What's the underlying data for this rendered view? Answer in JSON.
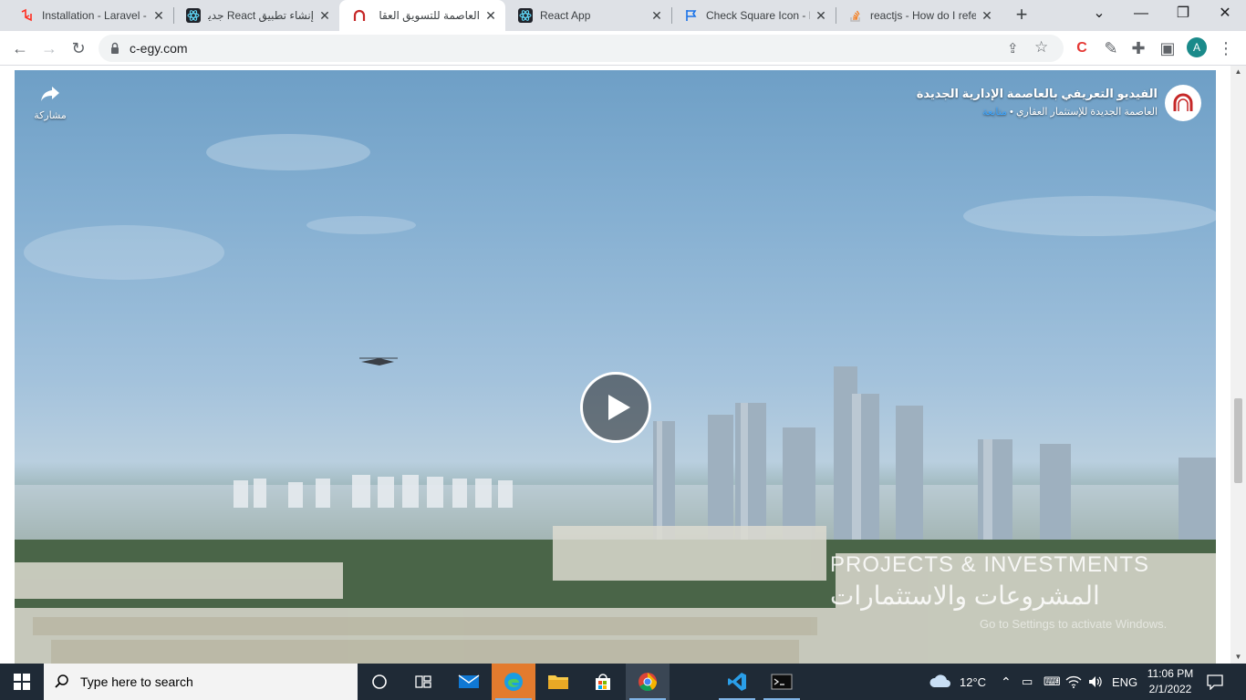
{
  "browser": {
    "tabs": [
      {
        "title": "Installation - Laravel -",
        "icon": "laravel-icon",
        "active": false
      },
      {
        "title": "إنشاء تطبيق React جديد",
        "icon": "react-icon",
        "active": false
      },
      {
        "title": "العاصمة للتسويق العقا",
        "icon": "capital-logo-icon",
        "active": true
      },
      {
        "title": "React App",
        "icon": "react-icon",
        "active": false
      },
      {
        "title": "Check Square Icon - R",
        "icon": "flag-icon",
        "active": false
      },
      {
        "title": "reactjs - How do I refe",
        "icon": "stackoverflow-icon",
        "active": false
      }
    ],
    "url": "c-egy.com",
    "profile_initial": "A"
  },
  "video": {
    "title": "الفيديو التعريفي بالعاصمة الإدارية الجديدة",
    "channel": "العاصمة الجديدة للإستثمار العقاري",
    "follow_label": "متابعة",
    "share_label": "مشاركة",
    "overlay_en": "PROJECTS & INVESTMENTS",
    "overlay_ar": "المشروعات والاستثمارات",
    "watermark": "Go to Settings to activate Windows."
  },
  "taskbar": {
    "search_placeholder": "Type here to search",
    "weather": "12°C",
    "language": "ENG",
    "time": "11:06 PM",
    "date": "2/1/2022"
  },
  "colors": {
    "accent": "#c62828",
    "tab_strip": "#dee1e6",
    "taskbar": "#1f2a36",
    "link": "#3ea6ff"
  }
}
